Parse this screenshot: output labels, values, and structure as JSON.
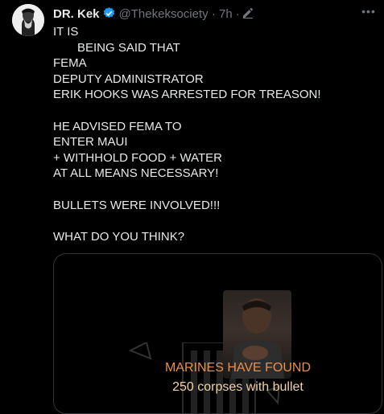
{
  "tweet": {
    "author_name": "DR. Kek",
    "handle": "@Thekeksociety",
    "separator": "·",
    "time": "7h",
    "time_separator": "·",
    "lines": [
      "IT IS",
      "BEING SAID THAT",
      "FEMA",
      "DEPUTY ADMINISTRATOR",
      "ERIK HOOKS WAS ARRESTED FOR TREASON!",
      "",
      "HE ADVISED FEMA TO",
      "ENTER MAUI",
      "+ WITHHOLD FOOD + WATER",
      "AT ALL MEANS NECESSARY!",
      "",
      "BULLETS WERE INVOLVED!!!",
      "",
      "WHAT DO YOU THINK?"
    ]
  },
  "media": {
    "caption_line_1": "MARINES HAVE FOUND",
    "caption_line_2": "250 corpses with bullet"
  },
  "icons": {
    "verified": "verified-badge-icon",
    "edit": "edited-pencil-icon",
    "more": "more-options-icon"
  },
  "colors": {
    "background": "#000000",
    "text": "#e7e9ea",
    "secondary": "#71767b",
    "verified": "#1d9bf0",
    "caption_orange": "#e8904b"
  }
}
